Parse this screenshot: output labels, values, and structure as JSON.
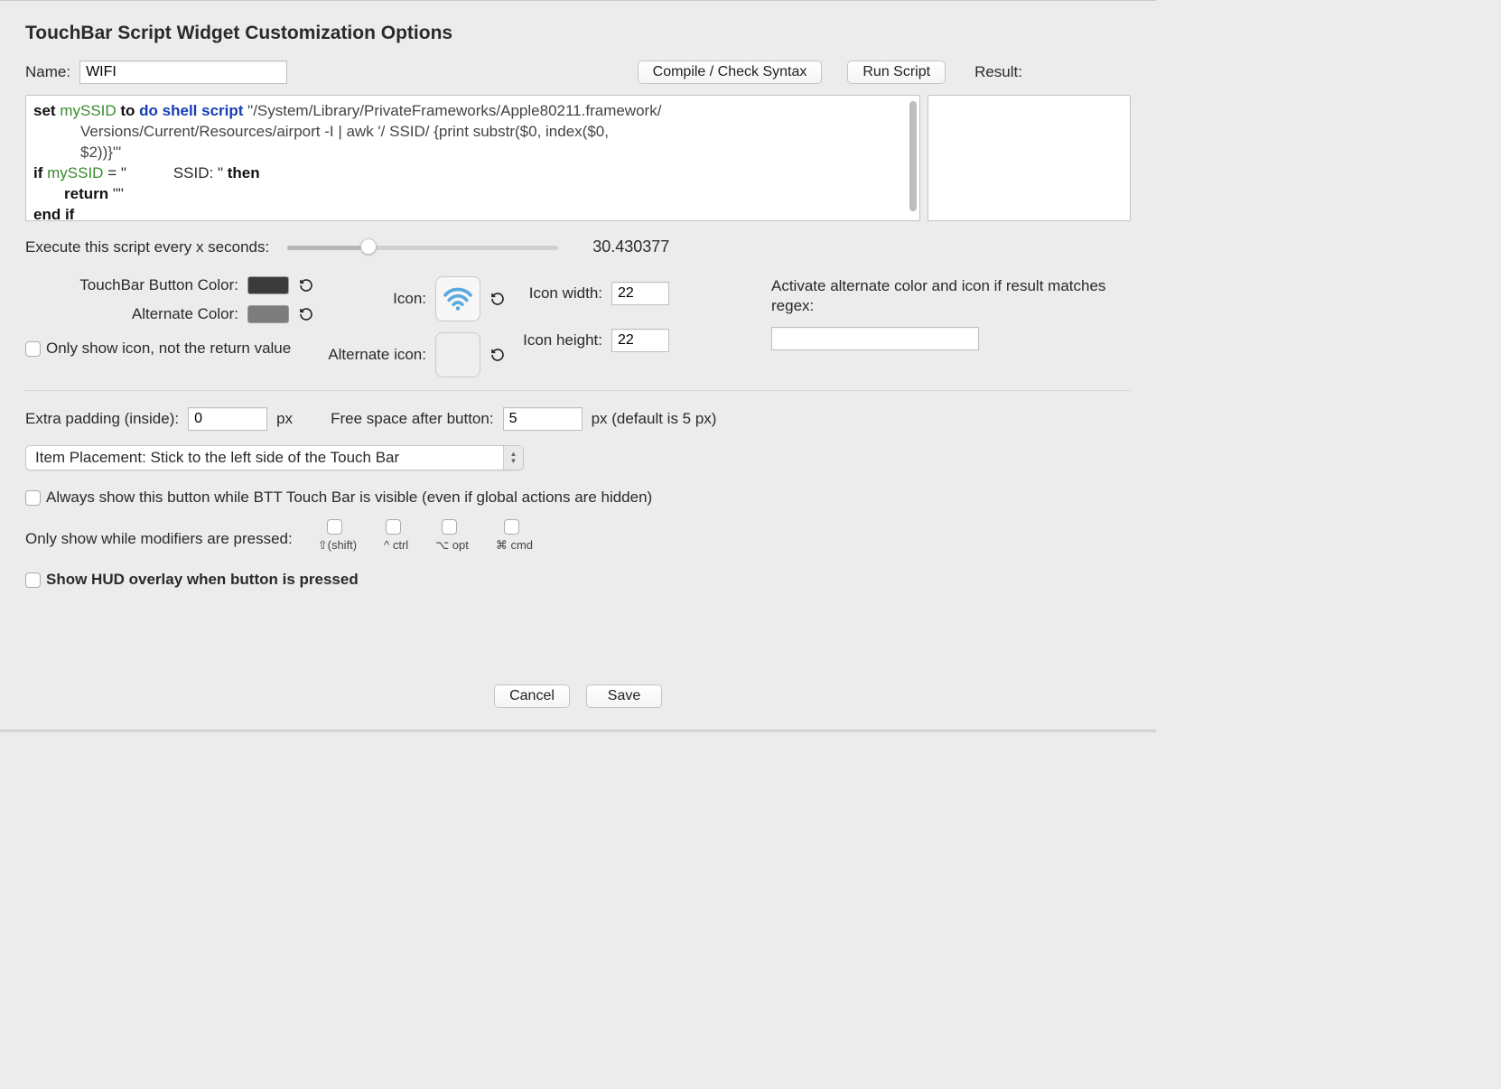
{
  "title": "TouchBar Script Widget Customization Options",
  "top": {
    "name_label": "Name:",
    "name_value": "WIFI",
    "compile_btn": "Compile / Check Syntax",
    "run_btn": "Run Script",
    "result_label": "Result:"
  },
  "script": {
    "html": "<span class='kw'>set</span> <span class='var'>mySSID</span> <span class='kw'>to</span> <span class='cmd'>do shell script</span> <span class='str'>\"/System/Library/PrivateFrameworks/Apple80211.framework/</span><span class='script-indent str'>Versions/Current/Resources/airport -I | awk '/ SSID/ {print substr($0, index($0,</span><span class='script-indent str'>$2))}'\"</span><span><span class='kw'>if</span> <span class='var'>mySSID</span> = \"&nbsp;&nbsp;&nbsp;&nbsp;&nbsp;&nbsp;&nbsp;&nbsp;&nbsp;&nbsp; SSID: \" <span class='kw'>then</span></span><span style='display:block;padding-left:34px'><span class='kw'>return</span> \"\"</span><span class='kw'>end if</span><br><span class='kw'>return</span> <span class='var'>mySSID</span> <span class='kw'>as</span> <span class='typ'>string</span>"
  },
  "interval": {
    "label": "Execute this script every x seconds:",
    "value": "30.430377"
  },
  "colors": {
    "button_color_label": "TouchBar Button Color:",
    "alt_color_label": "Alternate Color:",
    "only_icon_label": "Only show icon, not the return value"
  },
  "icons": {
    "icon_label": "Icon:",
    "alt_icon_label": "Alternate icon:",
    "width_label": "Icon width:",
    "height_label": "Icon height:",
    "width_value": "22",
    "height_value": "22"
  },
  "regex": {
    "label": "Activate alternate color and icon if result matches regex:",
    "value": ""
  },
  "padding": {
    "extra_label": "Extra padding (inside):",
    "extra_value": "0",
    "px": "px",
    "free_label": "Free space after button:",
    "free_value": "5",
    "free_suffix": "px (default is 5 px)"
  },
  "placement": {
    "value": "Item Placement: Stick to the left side of the Touch Bar"
  },
  "always_show_label": "Always show this button while BTT Touch Bar is visible (even if global actions are hidden)",
  "modifiers": {
    "label": "Only show while modifiers are pressed:",
    "shift": "⇧(shift)",
    "ctrl": "^ ctrl",
    "opt": "⌥ opt",
    "cmd": "⌘ cmd"
  },
  "hud_label": "Show HUD overlay when button is pressed",
  "footer": {
    "cancel": "Cancel",
    "save": "Save"
  }
}
